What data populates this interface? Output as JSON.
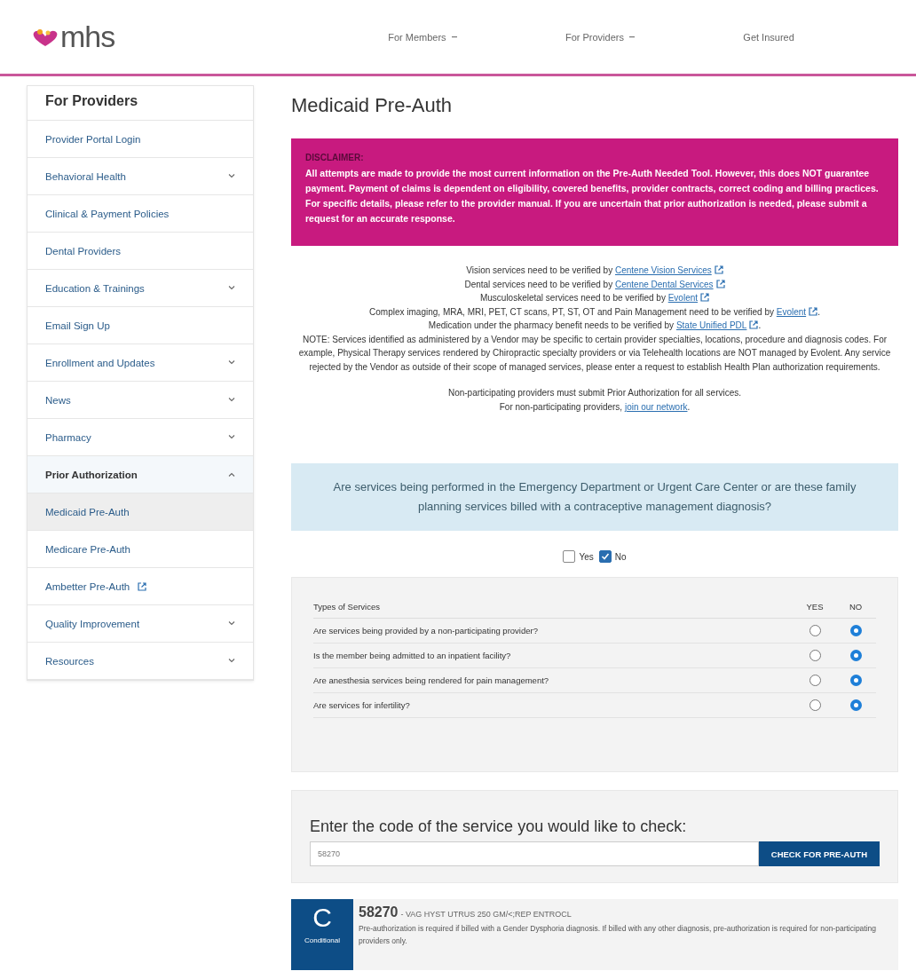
{
  "header": {
    "logo": "mhs",
    "nav": [
      {
        "label": "For Members",
        "dropdown": true
      },
      {
        "label": "For Providers",
        "dropdown": true
      },
      {
        "label": "Get Insured",
        "dropdown": false
      }
    ]
  },
  "sidebar": {
    "title": "For Providers",
    "items": [
      {
        "label": "Provider Portal Login",
        "kind": "link",
        "selected": false
      },
      {
        "label": "Behavioral Health",
        "kind": "group",
        "expanded": false,
        "selected": false
      },
      {
        "label": "Clinical & Payment Policies",
        "kind": "link",
        "selected": false
      },
      {
        "label": "Dental Providers",
        "kind": "link",
        "selected": false
      },
      {
        "label": "Education & Trainings",
        "kind": "group",
        "expanded": false,
        "selected": false
      },
      {
        "label": "Email Sign Up",
        "kind": "link",
        "selected": false
      },
      {
        "label": "Enrollment and Updates",
        "kind": "group",
        "expanded": false,
        "selected": false
      },
      {
        "label": "News",
        "kind": "group",
        "expanded": false,
        "selected": false
      },
      {
        "label": "Pharmacy",
        "kind": "group",
        "expanded": false,
        "selected": false
      },
      {
        "label": "Prior Authorization",
        "kind": "group",
        "expanded": true,
        "selected": false,
        "children": [
          {
            "label": "Medicaid Pre-Auth",
            "kind": "link",
            "selected": true
          },
          {
            "label": "Medicare Pre-Auth",
            "kind": "link",
            "selected": false
          },
          {
            "label": "Ambetter Pre-Auth",
            "kind": "external",
            "selected": false
          }
        ]
      },
      {
        "label": "Quality Improvement",
        "kind": "group",
        "expanded": false,
        "selected": false
      },
      {
        "label": "Resources",
        "kind": "group",
        "expanded": false,
        "selected": false
      }
    ]
  },
  "main": {
    "title": "Medicaid Pre-Auth",
    "disclaimer": {
      "heading": "DISCLAIMER:",
      "text": "All attempts are made to provide the most current information on the Pre-Auth Needed Tool. However, this does NOT guarantee payment. Payment of claims is dependent on eligibility, covered benefits, provider contracts, correct coding and billing practices. For specific details, please refer to the provider manual. If you are uncertain that prior authorization is needed, please submit a request for an accurate response."
    },
    "verification_lines": [
      {
        "before": "Vision services need to be verified by ",
        "link": "Centene Vision Services",
        "external": true
      },
      {
        "before": "Dental services need to be verified by ",
        "link": "Centene Dental Services",
        "external": true
      },
      {
        "before": "Musculoskeletal services need to be verified by ",
        "link": "Evolent",
        "external": true
      },
      {
        "before": "Complex imaging, MRA, MRI, PET, CT scans, PT, ST, OT and Pain Management need to be verified by ",
        "link": "Evolent",
        "external": true,
        "after": "."
      },
      {
        "before": "Medication under the pharmacy benefit needs to be verified by ",
        "link": "State Unified PDL",
        "external": true,
        "after": "."
      }
    ],
    "note": "NOTE: Services identified as administered by a Vendor may be specific to certain provider specialties, locations, procedure and diagnosis codes. For example, Physical Therapy services rendered by Chiropractic specialty providers or via Telehealth locations are NOT managed by Evolent. Any service rejected by the Vendor as outside of their scope of managed services, please enter a request to establish Health Plan authorization requirements.",
    "non_participating": "Non-participating providers must submit Prior Authorization for all services.",
    "network_line": {
      "before": "For non-participating providers, ",
      "link": "join our network",
      "external": false,
      "after": "."
    },
    "question": "Are services being performed in the Emergency Department or Urgent Care Center or are these family planning services billed with a contraceptive management diagnosis?",
    "answers": [
      {
        "label": "Yes",
        "checked": false
      },
      {
        "label": "No",
        "checked": true
      }
    ],
    "services_table": {
      "columns": [
        "Types of Services",
        "YES",
        "NO"
      ],
      "rows": [
        {
          "question": "Are services being provided by a non-participating provider?",
          "options": [
            {
              "selected": false
            },
            {
              "selected": true
            }
          ]
        },
        {
          "question": "Is the member being admitted to an inpatient facility?",
          "options": [
            {
              "selected": false
            },
            {
              "selected": true
            }
          ]
        },
        {
          "question": "Are anesthesia services being rendered for pain management?",
          "options": [
            {
              "selected": false
            },
            {
              "selected": true
            }
          ]
        },
        {
          "question": "Are services for infertility?",
          "options": [
            {
              "selected": false
            },
            {
              "selected": true
            }
          ]
        }
      ]
    },
    "code_check": {
      "heading": "Enter the code of the service you would like to check:",
      "value": "58270",
      "button": "CHECK FOR PRE-AUTH"
    },
    "result": {
      "letter": "C",
      "status": "Conditional",
      "code": "58270",
      "description": "- VAG HYST UTRUS 250 GM/<;REP ENTROCL",
      "text": "Pre-authorization is required if billed with a Gender Dysphoria diagnosis. If billed with any other diagnosis, pre-authorization is required for non-participating providers only."
    }
  }
}
